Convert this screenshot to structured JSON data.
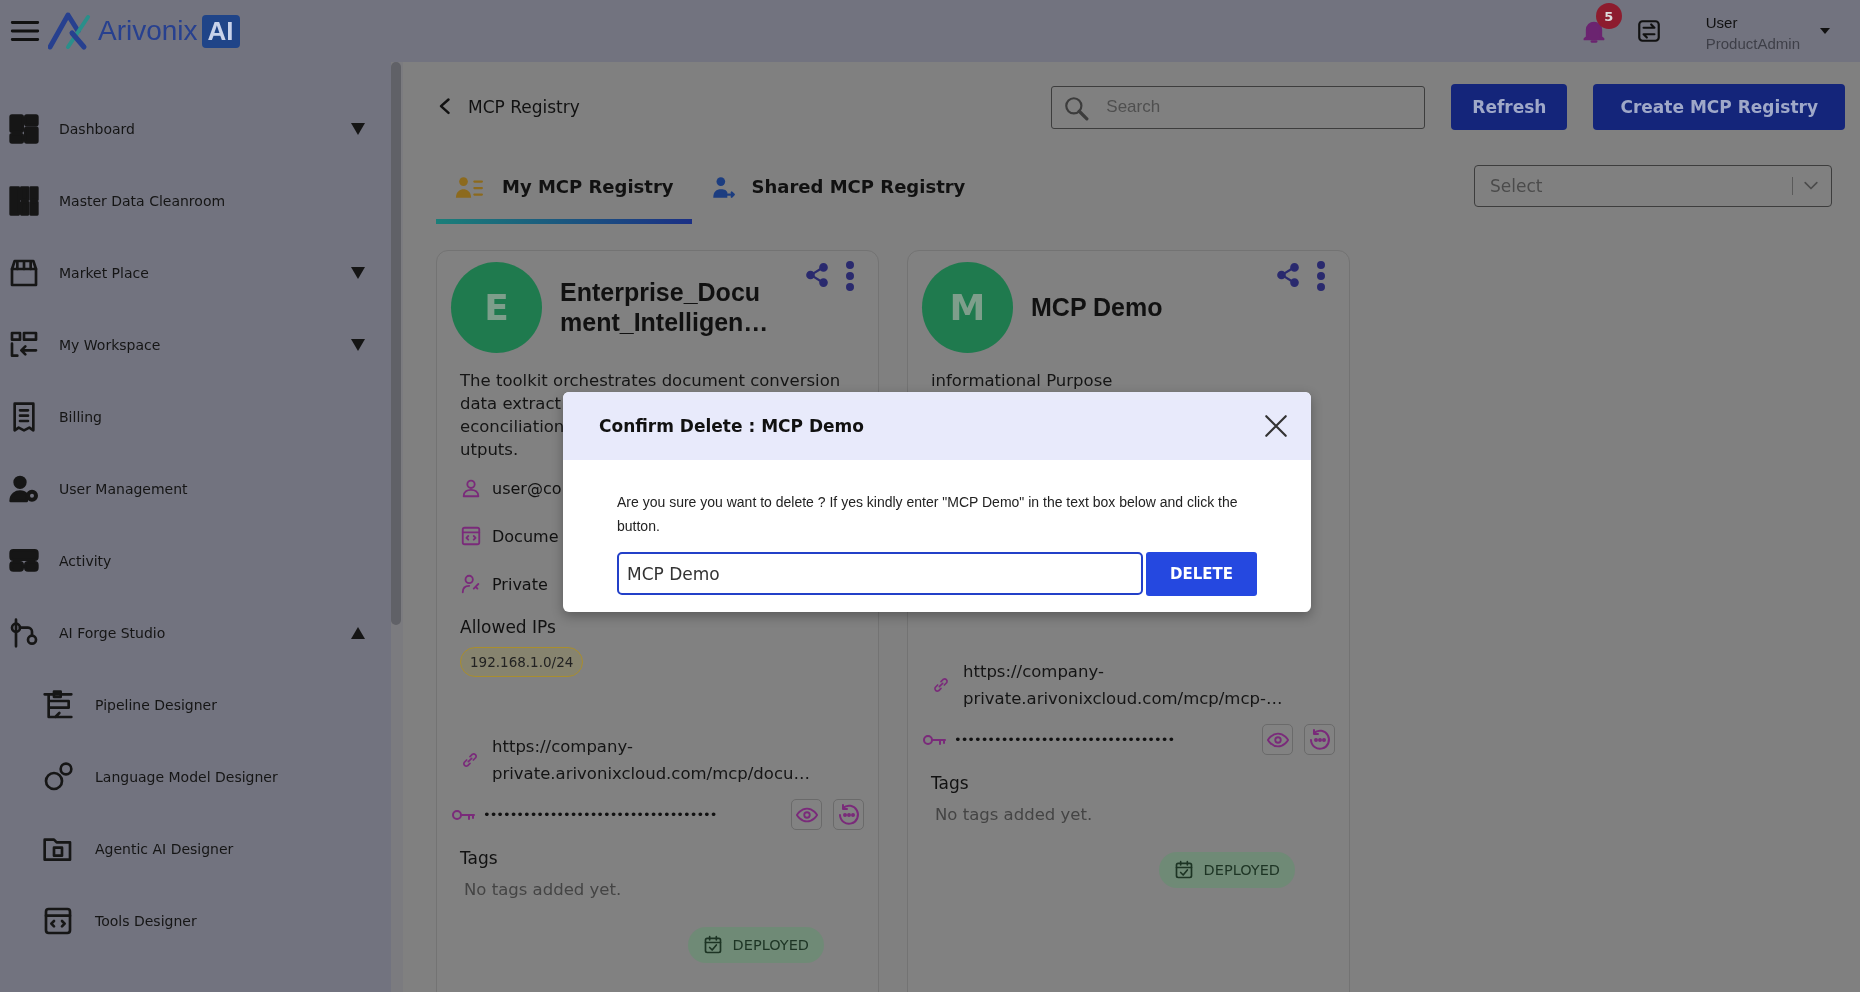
{
  "header": {
    "brand": "Arivonix",
    "brand_badge": "AI",
    "notifications": "5",
    "user": {
      "name": "User",
      "role": "ProductAdmin"
    }
  },
  "sidebar": {
    "items": [
      {
        "label": "Dashboard",
        "expanded": false
      },
      {
        "label": "Master Data Cleanroom"
      },
      {
        "label": "Market Place",
        "expanded": false
      },
      {
        "label": "My Workspace",
        "expanded": false
      },
      {
        "label": "Billing"
      },
      {
        "label": "User Management"
      },
      {
        "label": "Activity"
      },
      {
        "label": "AI Forge Studio",
        "expanded": true,
        "children": [
          {
            "label": "Pipeline Designer"
          },
          {
            "label": "Language Model Designer"
          },
          {
            "label": "Agentic AI Designer"
          },
          {
            "label": "Tools Designer"
          }
        ]
      }
    ]
  },
  "page": {
    "title": "MCP Registry",
    "search": {
      "placeholder": "Search"
    },
    "buttons": [
      "Refresh",
      "Create MCP Registry"
    ],
    "tabs": [
      {
        "label": "My MCP Registry",
        "selected": true
      },
      {
        "label": "Shared MCP Registry",
        "selected": false
      }
    ],
    "filter": {
      "placeholder": "Select"
    }
  },
  "cards": [
    {
      "initial": "E",
      "title": "Enterprise_Document_Intelligen…",
      "description_lines": [
        "The toolkit orchestrates document conversion",
        "data extract",
        "econciliation",
        "utputs."
      ],
      "details": [
        {
          "kind": "owner",
          "text": "user@co"
        },
        {
          "kind": "type",
          "text": "Docume"
        },
        {
          "kind": "visibility",
          "text": "Private"
        }
      ],
      "allowed_ips_label": "Allowed IPs",
      "allowed_ips": [
        "192.168.1.0/24"
      ],
      "endpoint": "https://company-private.arivonixcloud.com/mcp/docu…",
      "secret": "•••••••••••••••••••••••••••••••••••",
      "tags_label": "Tags",
      "tags_empty": "No tags added yet.",
      "status": "DEPLOYED"
    },
    {
      "initial": "M",
      "title": "MCP Demo",
      "description_lines": [
        "informational Purpose"
      ],
      "endpoint": "https://company-private.arivonixcloud.com/mcp/mcp-…",
      "secret": "•••••••••••••••••••••••••••••••••",
      "tags_label": "Tags",
      "tags_empty": "No tags added yet.",
      "status": "DEPLOYED"
    }
  ],
  "dialog": {
    "title": "Confirm Delete : MCP Demo",
    "message": "Are you sure you want to delete ? If yes kindly enter \"MCP Demo\" in the text box below and click the button.",
    "value": "MCP Demo",
    "button": "DELETE"
  }
}
